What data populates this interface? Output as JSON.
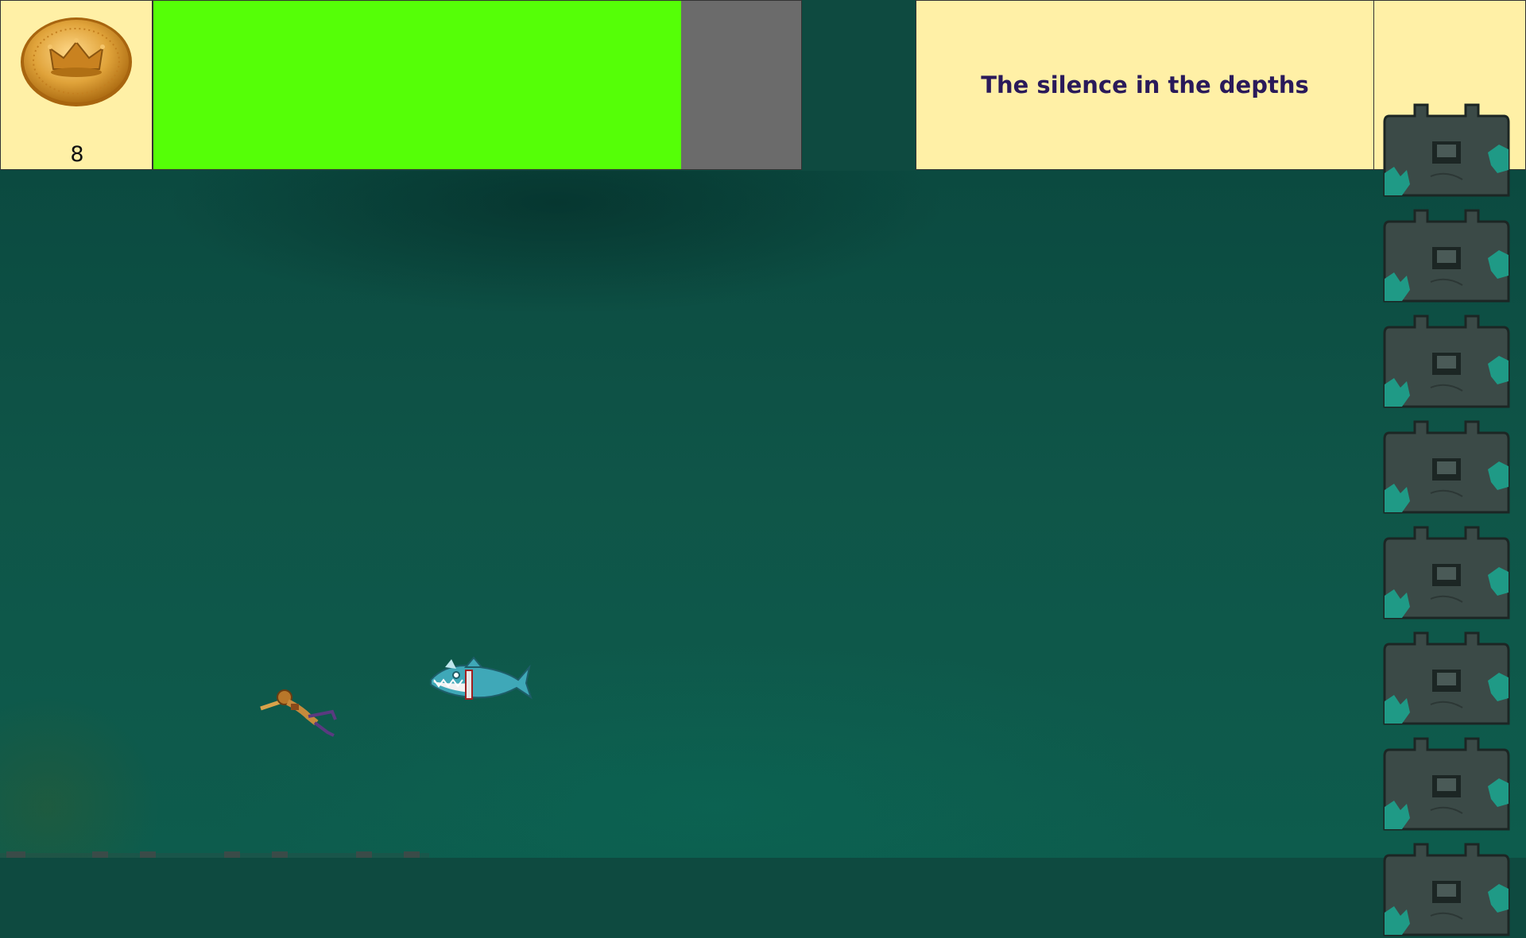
{
  "hud": {
    "coin_icon": "crown-coin-icon",
    "coin_count": "8",
    "health_fraction": 0.815,
    "health_color": "#55ff07",
    "level_title": "The silence in the depths"
  },
  "scene": {
    "background_color": "#0e4a40",
    "player": "diver-sprite",
    "enemy": "shark-sprite",
    "wall_blocks": 8
  }
}
